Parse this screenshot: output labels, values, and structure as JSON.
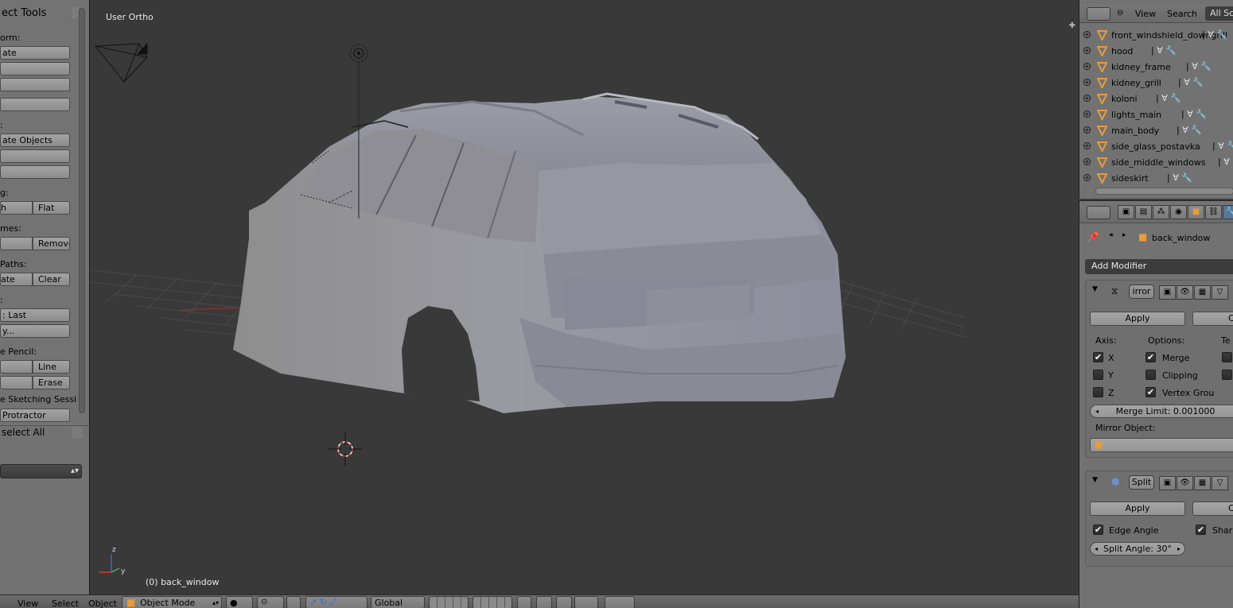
{
  "toolshelf": {
    "title": "ect Tools",
    "labels": {
      "transform": "orm:",
      "edit": ":",
      "shading": "g:",
      "keyframes": "mes:",
      "motion_paths": "Paths:",
      "history": ":",
      "grease_pencil": "e Pencil:"
    },
    "buttons": {
      "translate": "ate",
      "rotate": "",
      "scale": "",
      "mirror": "",
      "duplicate": "ate Objects",
      "dup_linked": "",
      "join": "",
      "smooth": "h",
      "flat": "Flat",
      "insert": "",
      "remove": "Remove",
      "calculate": "ate",
      "clear": "Clear",
      "repeat_last": ": Last",
      "repeat_history": "y...",
      "draw": "",
      "line": "Line",
      "poly": "",
      "erase": "Erase",
      "sketching": "e Sketching Sessi",
      "protractor": "Protractor"
    },
    "last_operator": "select All",
    "dropdown_value": ""
  },
  "viewport": {
    "view_name": "User Ortho",
    "active_object": "(0) back_window"
  },
  "bottombar": {
    "menu": [
      "View",
      "Select",
      "Object"
    ],
    "mode": "Object Mode",
    "orientation": "Global"
  },
  "outliner": {
    "header": {
      "view": "View",
      "search": "Search",
      "scenes": "All Scenes"
    },
    "items": [
      {
        "name": "front_windshield_downgrill"
      },
      {
        "name": "hood"
      },
      {
        "name": "kidney_frame"
      },
      {
        "name": "kidney_grill"
      },
      {
        "name": "koloni"
      },
      {
        "name": "lights_main"
      },
      {
        "name": "main_body"
      },
      {
        "name": "side_glass_postavka"
      },
      {
        "name": "side_middle_windows"
      },
      {
        "name": "sideskirt"
      }
    ]
  },
  "properties": {
    "object_name": "back_window",
    "add_modifier": "Add Modifier",
    "mirror": {
      "name": "irror",
      "apply": "Apply",
      "copy": "C",
      "axis_label": "Axis:",
      "options_label": "Options:",
      "tex_label": "Te",
      "axes": [
        {
          "label": "X",
          "checked": true
        },
        {
          "label": "Y",
          "checked": false
        },
        {
          "label": "Z",
          "checked": false
        }
      ],
      "options": [
        {
          "label": "Merge",
          "checked": true
        },
        {
          "label": "Clipping",
          "checked": false
        },
        {
          "label": "Vertex Grou",
          "checked": true
        }
      ],
      "merge_limit": "Merge Limit: 0.001000",
      "mirror_object_label": "Mirror Object:"
    },
    "edge_split": {
      "name": "Split",
      "apply": "Apply",
      "copy": "C",
      "edge_angle": "Edge Angle",
      "edge_angle_checked": true,
      "sharp": "Sharp",
      "sharp_checked": true,
      "split_angle": "Split Angle: 30°"
    }
  },
  "colors": {
    "viewport_bg": "#393939",
    "panel_bg": "#727272",
    "accent": "#557799",
    "object_orange": "#e89b3c"
  }
}
